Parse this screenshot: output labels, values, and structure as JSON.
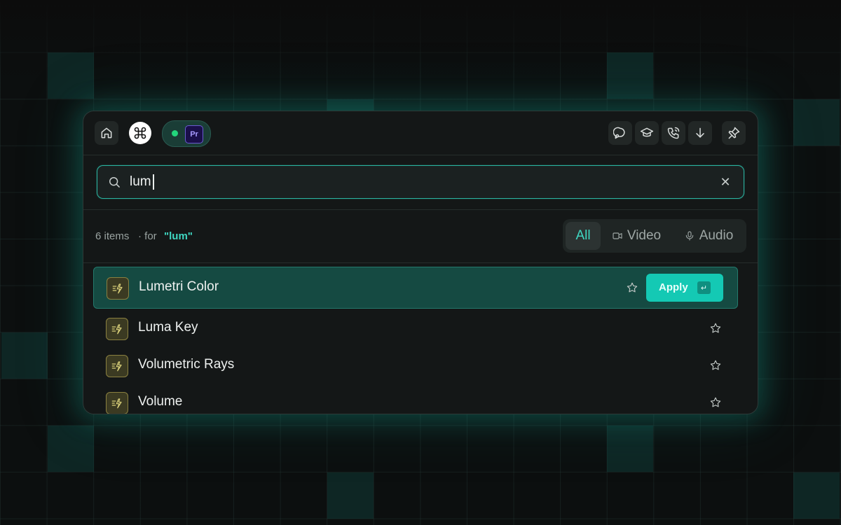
{
  "toolbar": {
    "home_icon": "home-icon",
    "command_icon": "command-icon",
    "app_status": "connected",
    "app_badge": "Pr",
    "right_icons": [
      "chat-icon",
      "graduation-cap-icon",
      "phone-icon",
      "arrow-down-icon"
    ],
    "pin_icon": "pin-icon"
  },
  "search": {
    "value": "lum",
    "clear_icon": "close-icon"
  },
  "summary": {
    "count": "6 items",
    "for_label": "· for",
    "query": "\"lum\""
  },
  "filters": [
    {
      "label": "All",
      "active": true
    },
    {
      "label": "Video",
      "icon": "video-icon",
      "active": false
    },
    {
      "label": "Audio",
      "icon": "microphone-icon",
      "active": false
    }
  ],
  "results": [
    {
      "label": "Lumetri Color",
      "selected": true
    },
    {
      "label": "Luma Key",
      "selected": false
    },
    {
      "label": "Volumetric Rays",
      "selected": false
    },
    {
      "label": "Volume",
      "selected": false
    }
  ],
  "apply": {
    "label": "Apply",
    "key": "↵"
  },
  "colors": {
    "accent": "#14c9b4",
    "highlight": "#3fd7c2",
    "selected_row": "#154a42",
    "panel": "#141717"
  }
}
